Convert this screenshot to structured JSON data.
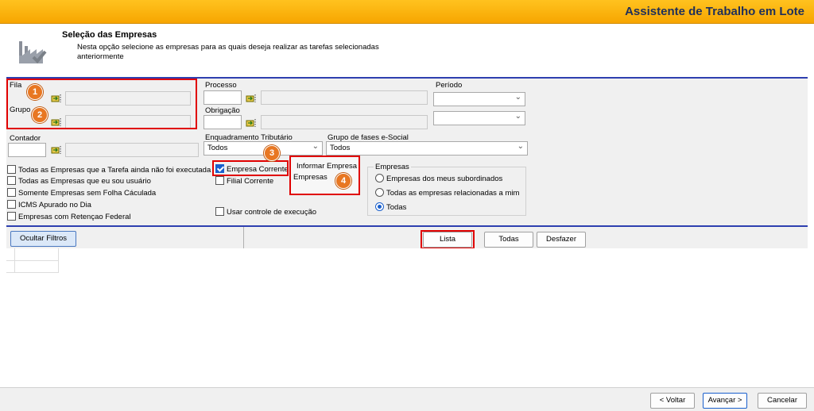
{
  "window": {
    "title": "Assistente de Trabalho em Lote"
  },
  "header": {
    "title": "Seleção das Empresas",
    "description": "Nesta opção selecione as empresas para as quais deseja realizar as tarefas selecionadas anteriormente"
  },
  "filters": {
    "fila_label": "Fila",
    "grupo_label": "Grupo",
    "contador_label": "Contador",
    "processo_label": "Processo",
    "obrigacao_label": "Obrigação",
    "periodo_label": "Período",
    "enquadramento_label": "Enquadramento Tributário",
    "enquadramento_value": "Todos",
    "grupo_fases_label": "Grupo de fases e-Social",
    "grupo_fases_value": "Todos"
  },
  "checkboxes": [
    {
      "label": "Todas as Empresas que a Tarefa ainda não foi executada",
      "checked": false
    },
    {
      "label": "Todas as Empresas que eu sou usuário",
      "checked": false
    },
    {
      "label": "Somente Empresas sem Folha Cáculada",
      "checked": false
    },
    {
      "label": "ICMS Apurado no Dia",
      "checked": false
    },
    {
      "label": "Empresas com Retençao Federal",
      "checked": false
    }
  ],
  "empresa_corrente": {
    "label": "Empresa Corrente",
    "checked": true
  },
  "filial_corrente": {
    "label": "Filial Corrente",
    "checked": false
  },
  "usar_controle": {
    "label": "Usar controle de execução",
    "checked": false
  },
  "informar": {
    "line1": "Informar Empresa",
    "line2": "Empresas"
  },
  "empresas_group": {
    "title": "Empresas",
    "options": [
      {
        "label": "Empresas dos meus subordinados",
        "selected": false
      },
      {
        "label": "Todas as empresas relacionadas a mim",
        "selected": false
      },
      {
        "label": "Todas",
        "selected": true
      }
    ]
  },
  "badges": [
    "1",
    "2",
    "3",
    "4"
  ],
  "toolbar": {
    "ocultar_filtros": "Ocultar Filtros",
    "lista": "Lista",
    "todas": "Todas",
    "desfazer": "Desfazer"
  },
  "footer": {
    "voltar": "< Voltar",
    "avancar": "Avançar >",
    "cancelar": "Cancelar"
  },
  "colors": {
    "accent": "#f7a600",
    "highlight": "#e00000",
    "badge": "#e87722",
    "divider": "#2e3fb0"
  }
}
